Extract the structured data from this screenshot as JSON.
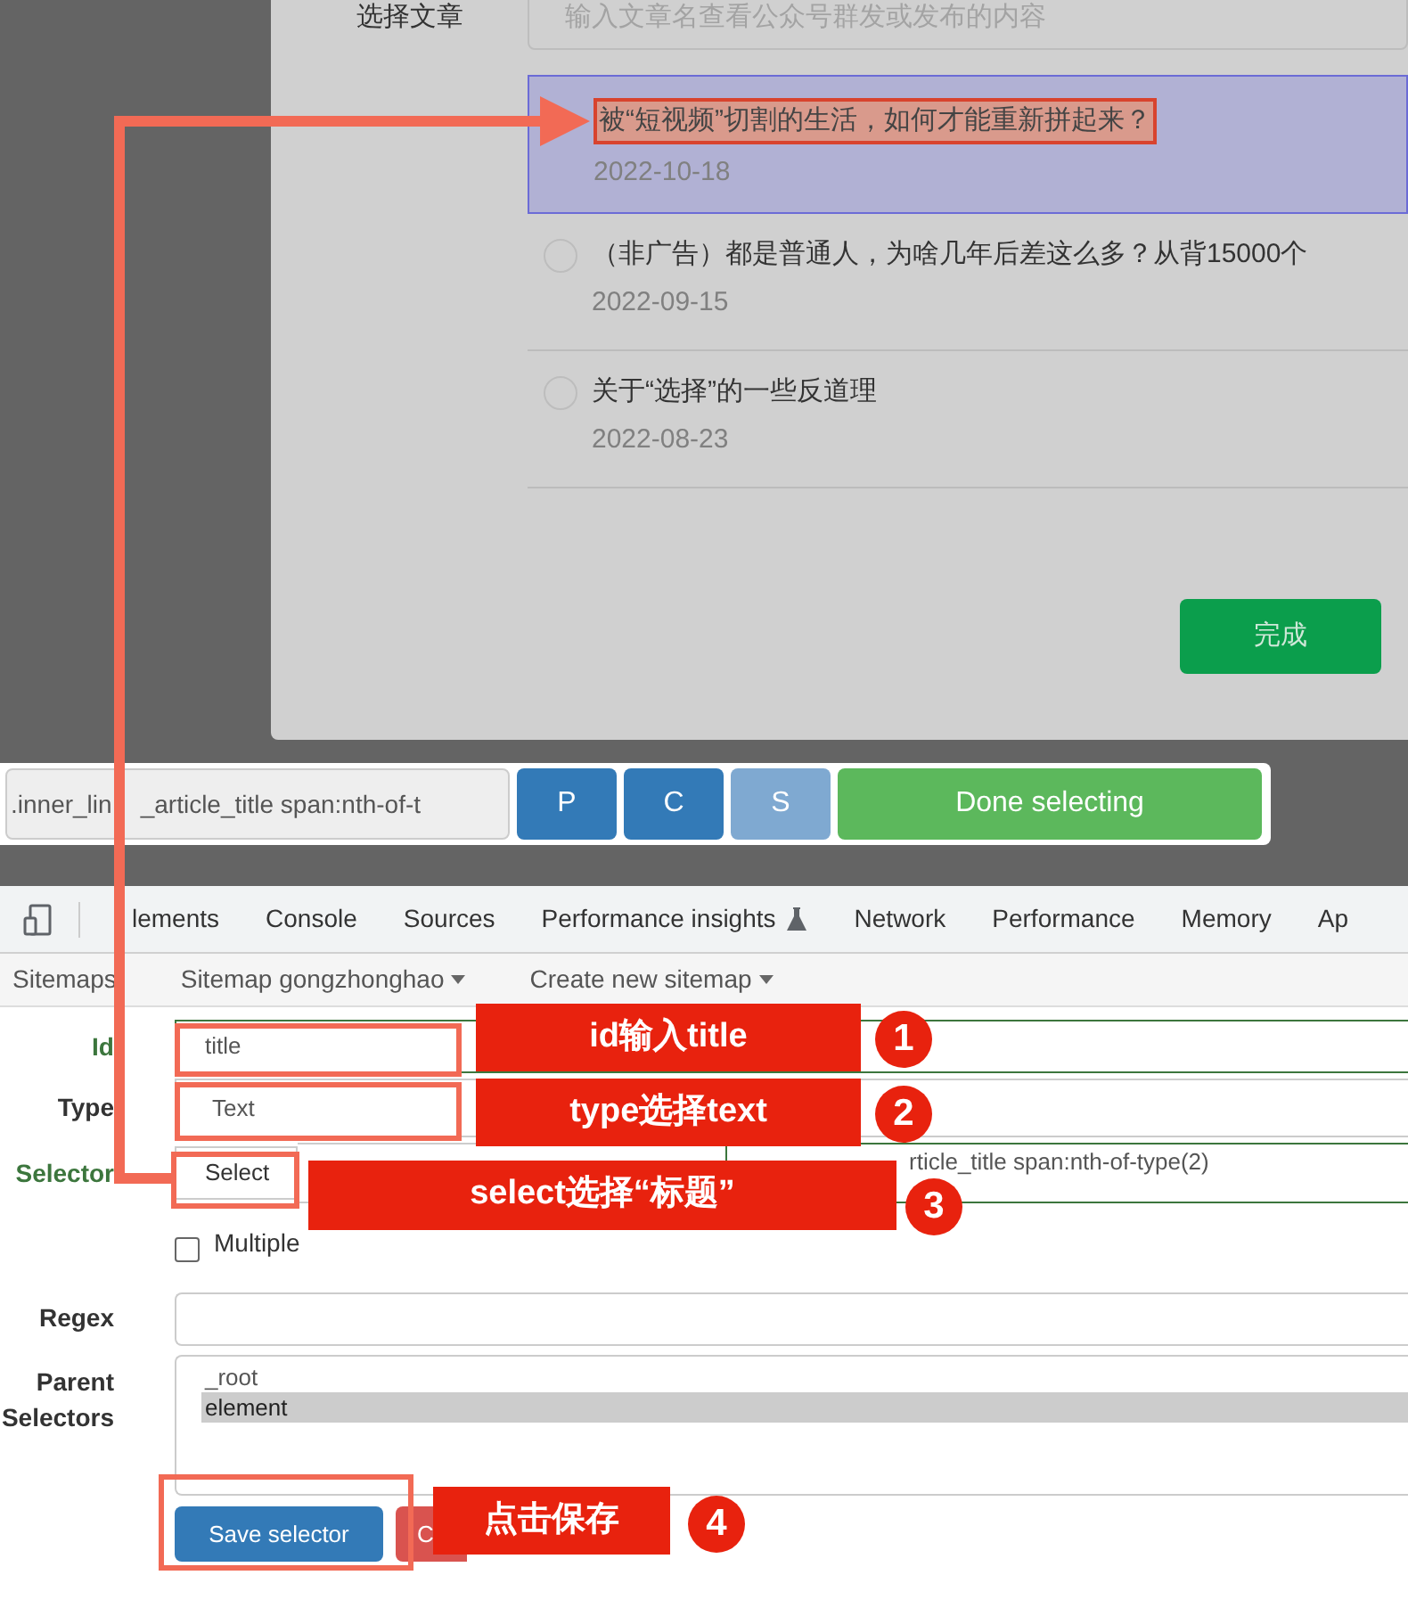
{
  "modal": {
    "label": "选择文章",
    "search": {
      "placeholder": "输入文章名查看公众号群发或发布的内容"
    },
    "articles": [
      {
        "title": "被“短视频”切割的生活，如何才能重新拼起来？",
        "date": "2022-10-18",
        "selected": true,
        "highlighted": true
      },
      {
        "title": "（非广告）都是普通人，为啥几年后差这么多？从背15000个",
        "date": "2022-09-15",
        "selected": false,
        "highlighted": false
      },
      {
        "title": "关于“选择”的一些反道理",
        "date": "2022-08-23",
        "selected": false,
        "highlighted": false
      }
    ],
    "done_button": "完成"
  },
  "selector_bar": {
    "value_parts": [
      ".inner_lin",
      "_article_title span:nth-of-t"
    ],
    "buttons": [
      {
        "label": "P",
        "disabled": false
      },
      {
        "label": "C",
        "disabled": false
      },
      {
        "label": "S",
        "disabled": true
      }
    ],
    "done_button": "Done selecting"
  },
  "devtools_tabs": [
    {
      "label": "lements",
      "kind": "text"
    },
    {
      "label": "Console",
      "kind": "text"
    },
    {
      "label": "Sources",
      "kind": "text"
    },
    {
      "label": "Performance insights",
      "kind": "flask"
    },
    {
      "label": "Network",
      "kind": "text"
    },
    {
      "label": "Performance",
      "kind": "text"
    },
    {
      "label": "Memory",
      "kind": "text"
    },
    {
      "label": "Ap",
      "kind": "text"
    }
  ],
  "sitemap_nav": [
    {
      "label": "Sitemaps",
      "dropdown": false
    },
    {
      "label": "Sitemap gongzhonghao",
      "dropdown": true
    },
    {
      "label": "Create new sitemap",
      "dropdown": true
    }
  ],
  "form": {
    "id": {
      "label": "Id",
      "value": "title"
    },
    "type": {
      "label": "Type",
      "value": "Text"
    },
    "selector": {
      "label": "Selector",
      "button": "Select",
      "value": "rticle_title span:nth-of-type(2)"
    },
    "multiple": {
      "label": "Multiple",
      "checked": false
    },
    "regex": {
      "label": "Regex"
    },
    "parent_selectors": {
      "label": "Parent Selectors",
      "options": [
        {
          "label": "_root",
          "selected": false
        },
        {
          "label": "element",
          "selected": true
        }
      ]
    },
    "save_button": "Save selector",
    "cancel_button": "C"
  },
  "annotations": [
    {
      "text": "id输入title",
      "number": "1"
    },
    {
      "text": "type选择text",
      "number": "2"
    },
    {
      "text": "select选择“标题”",
      "number": "3"
    },
    {
      "text": "点击保存",
      "number": "4"
    }
  ]
}
